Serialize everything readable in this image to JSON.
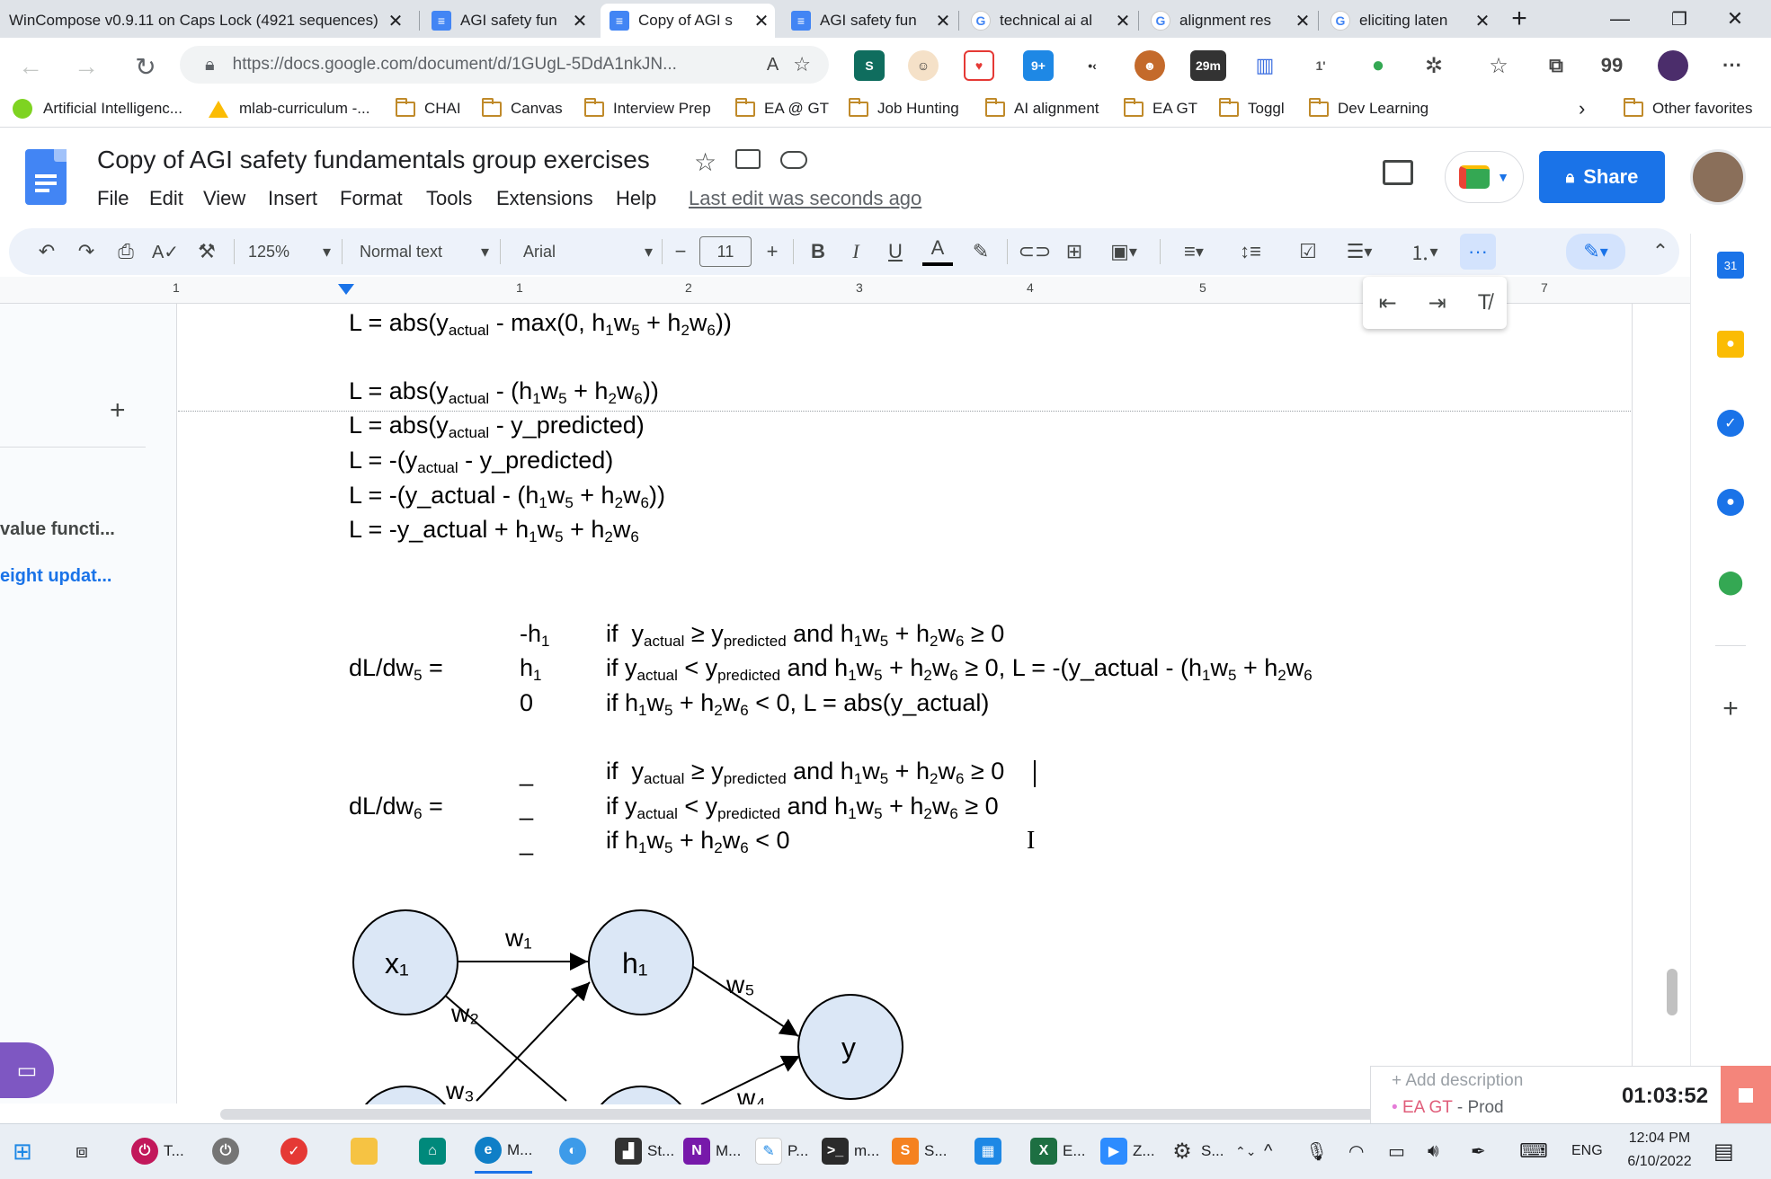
{
  "browser": {
    "tabs": [
      {
        "label": "WinCompose v0.9.11 on Caps Lock (4921 sequences)",
        "icon": "none"
      },
      {
        "label": "AGI safety fun",
        "icon": "docs-icon"
      },
      {
        "label": "Copy of AGI s",
        "icon": "docs-icon"
      },
      {
        "label": "AGI safety fun",
        "icon": "docs-icon"
      },
      {
        "label": "technical ai al",
        "icon": "google-icon"
      },
      {
        "label": "alignment res",
        "icon": "google-icon"
      },
      {
        "label": "eliciting laten",
        "icon": "google-icon"
      }
    ],
    "url": "https://docs.google.com/document/d/1GUgL-5DdA1nkJN...",
    "extension_badges": {
      "notif": "9+",
      "timer": "29m",
      "num": "1'",
      "quote": "99",
      "s_badge": "1"
    },
    "bookmarks": [
      {
        "label": "Artificial Intelligenc...",
        "icon": "smiley-icon"
      },
      {
        "label": "mlab-curriculum -...",
        "icon": "drive-icon"
      },
      {
        "label": "CHAI",
        "icon": "folder-icon"
      },
      {
        "label": "Canvas",
        "icon": "folder-icon"
      },
      {
        "label": "Interview Prep",
        "icon": "folder-icon"
      },
      {
        "label": "EA @ GT",
        "icon": "folder-icon"
      },
      {
        "label": "Job Hunting",
        "icon": "folder-icon"
      },
      {
        "label": "AI alignment",
        "icon": "folder-icon"
      },
      {
        "label": "EA GT",
        "icon": "folder-icon"
      },
      {
        "label": "Toggl",
        "icon": "folder-icon"
      },
      {
        "label": "Dev Learning",
        "icon": "folder-icon"
      }
    ],
    "other_favorites": "Other favorites"
  },
  "doc": {
    "title": "Copy of AGI safety fundamentals group exercises",
    "menu": [
      "File",
      "Edit",
      "View",
      "Insert",
      "Format",
      "Tools",
      "Extensions",
      "Help"
    ],
    "last_edit": "Last edit was seconds ago",
    "share_label": "Share",
    "toolbar": {
      "zoom": "125%",
      "style": "Normal text",
      "font": "Arial",
      "font_size": "11"
    },
    "ruler_numbers": [
      "1",
      "1",
      "2",
      "3",
      "4",
      "5",
      "7"
    ],
    "outline": {
      "item1": "value functi...",
      "item2": "eight updat..."
    }
  },
  "content": {
    "lines": {
      "l1": "L = abs(y<sub>actual</sub> - max(0, h<sub>1</sub>w<sub>5</sub> + h<sub>2</sub>w<sub>6</sub>))",
      "l2": "L = abs(y<sub>actual</sub> - (h<sub>1</sub>w<sub>5</sub> + h<sub>2</sub>w<sub>6</sub>))",
      "l3": "L = abs(y<sub>actual</sub> - y_predicted)",
      "l4": "L = -(y<sub>actual</sub> - y_predicted)",
      "l5": "L = -(y_actual - (h<sub>1</sub>w<sub>5</sub> + h<sub>2</sub>w<sub>6</sub>))",
      "l6": "L = -y_actual + h<sub>1</sub>w<sub>5</sub> + h<sub>2</sub>w<sub>6</sub>"
    },
    "dw5": {
      "label": "dL/dw<sub>5</sub> =",
      "cases": [
        "-h<sub>1</sub>",
        "h<sub>1</sub>",
        "0"
      ],
      "conds": [
        "if &nbsp;y<sub>actual</sub> ≥ y<sub>predicted</sub> and h<sub>1</sub>w<sub>5</sub> + h<sub>2</sub>w<sub>6</sub> ≥ 0",
        "if y<sub>actual</sub> &lt; y<sub>predicted</sub> and h<sub>1</sub>w<sub>5</sub> + h<sub>2</sub>w<sub>6</sub> ≥ 0, L = -(y_actual - (h<sub>1</sub>w<sub>5</sub> + h<sub>2</sub>w<sub>6</sub>",
        "if h<sub>1</sub>w<sub>5</sub> + h<sub>2</sub>w<sub>6</sub> &lt; 0, L = abs(y_actual)"
      ]
    },
    "dw6": {
      "label": "dL/dw<sub>6</sub> =",
      "cases": [
        "_",
        "_",
        "_"
      ],
      "conds": [
        "if &nbsp;y<sub>actual</sub> ≥ y<sub>predicted</sub> and h<sub>1</sub>w<sub>5</sub> + h<sub>2</sub>w<sub>6</sub> ≥ 0",
        "if y<sub>actual</sub> &lt; y<sub>predicted</sub> and h<sub>1</sub>w<sub>5</sub> + h<sub>2</sub>w<sub>6</sub> ≥ 0",
        "if h<sub>1</sub>w<sub>5</sub> + h<sub>2</sub>w<sub>6</sub> &lt; 0"
      ]
    },
    "diagram": {
      "nodes": {
        "x1": "x₁",
        "h1": "h₁",
        "y": "y"
      },
      "weights": {
        "w1": "w₁",
        "w2": "w₂",
        "w3": "w₃",
        "w5": "w₅",
        "w4": "w₄"
      }
    }
  },
  "timer": {
    "add_description": "+ Add description",
    "project": "EA GT",
    "project_suffix": "- Prod",
    "elapsed": "01:03:52"
  },
  "taskbar": {
    "apps": [
      "T...",
      "M...",
      "St...",
      "M...",
      "P...",
      "m...",
      "S...",
      "E...",
      "Z...",
      "S..."
    ],
    "lang": "ENG",
    "time": "12:04 PM",
    "date": "6/10/2022"
  },
  "colors": {
    "accent": "#1a73e8",
    "node_fill": "#dbe7f6",
    "toolbar_bg": "#edf2fa"
  }
}
